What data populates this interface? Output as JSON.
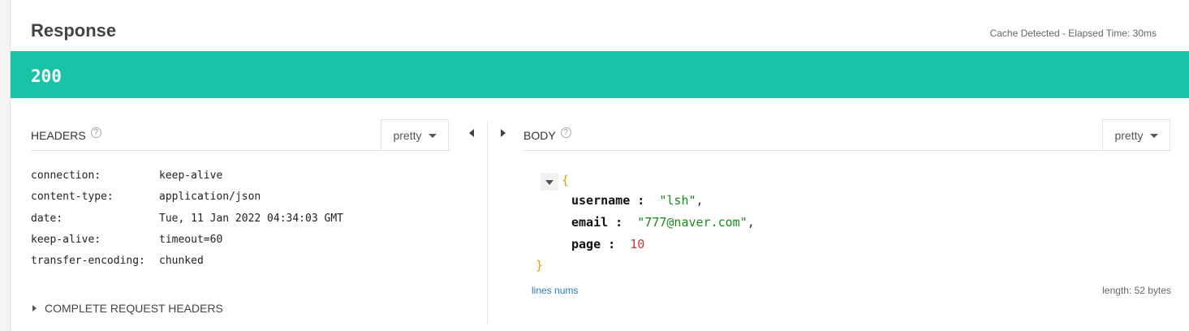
{
  "header": {
    "title": "Response",
    "cache_info": "Cache Detected - Elapsed Time: 30ms"
  },
  "status": {
    "code": "200",
    "color": "#18c4a7"
  },
  "headers_section": {
    "label": "HEADERS",
    "help_icon": "?",
    "format_select": "pretty",
    "rows": [
      {
        "key": "connection:",
        "value": "keep-alive"
      },
      {
        "key": "content-type:",
        "value": "application/json"
      },
      {
        "key": "date:",
        "value": "Tue, 11 Jan 2022 04:34:03 GMT"
      },
      {
        "key": "keep-alive:",
        "value": "timeout=60"
      },
      {
        "key": "transfer-encoding:",
        "value": "chunked"
      }
    ],
    "complete_request_headers": "COMPLETE REQUEST HEADERS"
  },
  "body_section": {
    "label": "BODY",
    "help_icon": "?",
    "format_select": "pretty",
    "json": {
      "open_brace": "{",
      "close_brace": "}",
      "fields": [
        {
          "key": "username",
          "sep": " :  ",
          "value": "\"lsh\"",
          "comma": ",",
          "type": "string"
        },
        {
          "key": "email",
          "sep": " :  ",
          "value": "\"777@naver.com\"",
          "comma": ",",
          "type": "string"
        },
        {
          "key": "page",
          "sep": " :  ",
          "value": "10",
          "comma": "",
          "type": "number"
        }
      ]
    },
    "lines_nums": "lines nums",
    "length": "length: 52 bytes"
  }
}
